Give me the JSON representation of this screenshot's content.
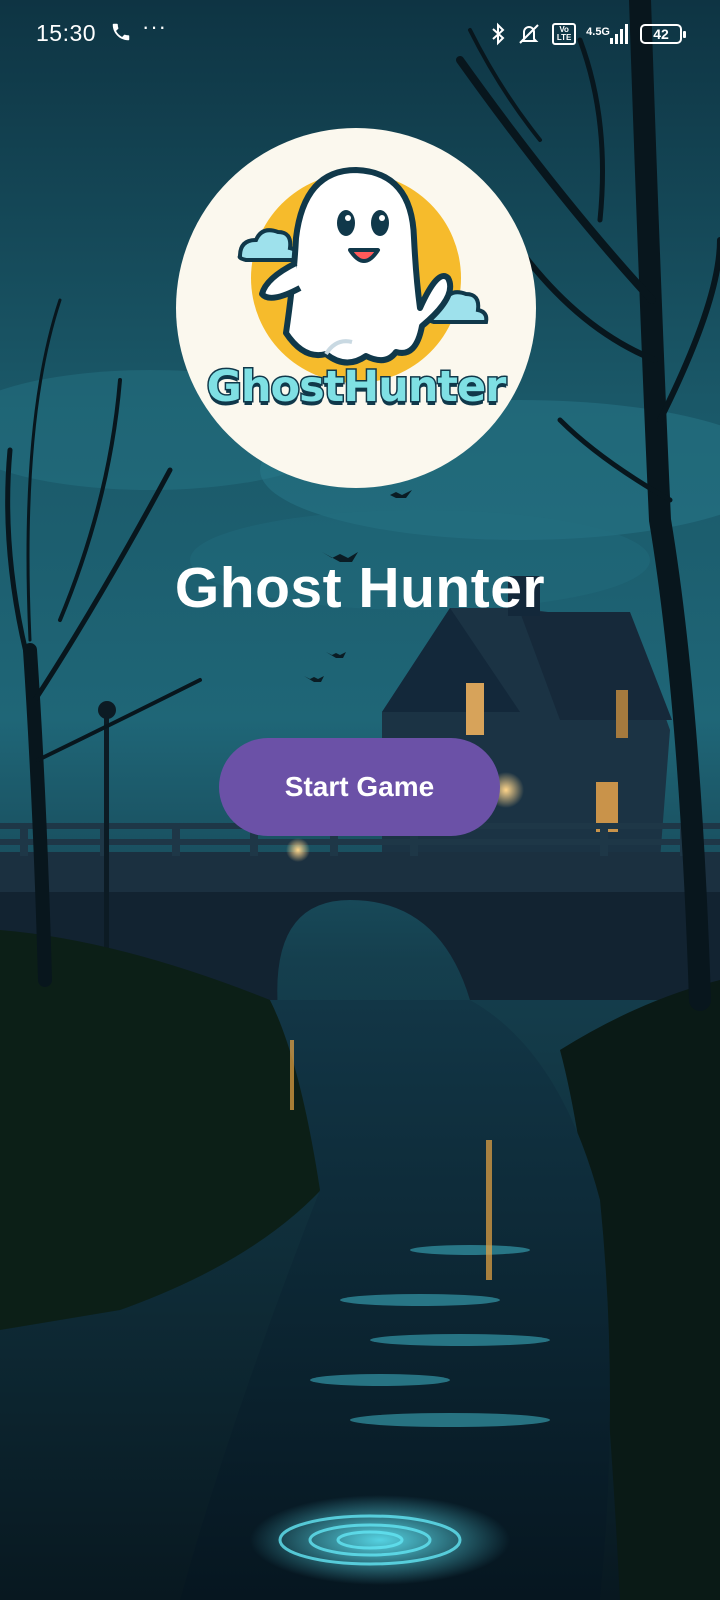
{
  "status_bar": {
    "time": "15:30",
    "volte_label": "Vo LTE",
    "network_type": "4.5G",
    "battery_level": "42",
    "icons": [
      "call-icon",
      "more-dots-icon",
      "bluetooth-icon",
      "mute-icon",
      "volte-icon",
      "signal-icon",
      "battery-icon"
    ]
  },
  "logo": {
    "wordmark": "GhostHunter",
    "icon": "ghost-icon",
    "colors": {
      "circle": "#fbf8ee",
      "sun": "#f6bb2c",
      "wordmark": "#7fe0e4",
      "outline": "#10384a"
    }
  },
  "main": {
    "title": "Ghost Hunter",
    "start_button_label": "Start Game",
    "accent_color": "#6b51a7"
  },
  "background": {
    "scene": "night-river-bridge-house",
    "colors": {
      "sky": "#1f6677",
      "water": "#0b2433",
      "glow": "#41d9f0"
    }
  }
}
